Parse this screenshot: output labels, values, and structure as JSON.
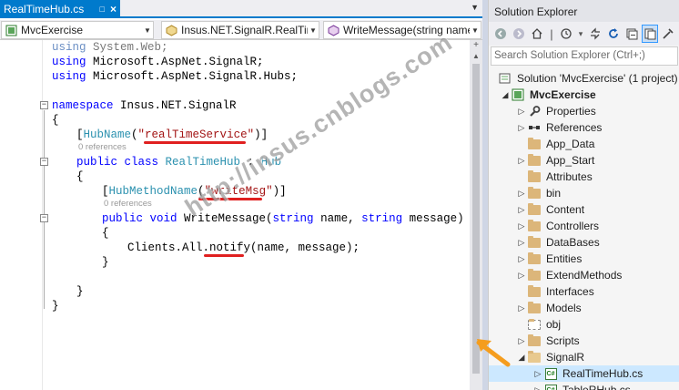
{
  "editor": {
    "tab": {
      "label": "RealTimeHub.cs",
      "pin": "□",
      "close": "×"
    },
    "tab_overflow": "▼",
    "nav": {
      "project": "MvcExercise",
      "class": "Insus.NET.SignalR.RealTim",
      "member": "WriteMessage(string name"
    },
    "code": {
      "l1": "using System.Web;",
      "l2": "using Microsoft.AspNet.SignalR;",
      "l3": "using Microsoft.AspNet.SignalR.Hubs;",
      "ns_kw": "namespace",
      "ns_name": " Insus.NET.SignalR",
      "brace_open": "{",
      "brace_close": "}",
      "attr1_pre": "[",
      "attr1_type": "HubName",
      "attr1_paren": "(",
      "attr1_str": "\"realTimeService\"",
      "attr1_post": ")]",
      "refs": "0 references",
      "class_kw": "public class",
      "class_name": "RealTimeHub",
      "class_sep": " : ",
      "class_base": "Hub",
      "attr2_type": "HubMethodName",
      "attr2_str": "\"writeMsg\"",
      "method_kw": "public void",
      "method_name": " WriteMessage(",
      "method_p1_kw": "string",
      "method_p1": " name, ",
      "method_p2_kw": "string",
      "method_p2": " message)",
      "call_pre": "Clients.All.",
      "call_fn": "notify",
      "call_post": "(name, message);"
    }
  },
  "solution_explorer": {
    "title": "Solution Explorer",
    "search_placeholder": "Search Solution Explorer (Ctrl+;)",
    "solution_label": "Solution 'MvcExercise' (1 project)",
    "project_label": "MvcExercise",
    "items": [
      {
        "label": "Properties",
        "icon": "wrench-icon"
      },
      {
        "label": "References",
        "icon": "references-icon"
      },
      {
        "label": "App_Data",
        "icon": "folder-icon"
      },
      {
        "label": "App_Start",
        "icon": "folder-icon"
      },
      {
        "label": "Attributes",
        "icon": "folder-icon"
      },
      {
        "label": "bin",
        "icon": "folder-icon"
      },
      {
        "label": "Content",
        "icon": "folder-icon"
      },
      {
        "label": "Controllers",
        "icon": "folder-icon"
      },
      {
        "label": "DataBases",
        "icon": "folder-icon"
      },
      {
        "label": "Entities",
        "icon": "folder-icon"
      },
      {
        "label": "ExtendMethods",
        "icon": "folder-icon"
      },
      {
        "label": "Interfaces",
        "icon": "folder-icon"
      },
      {
        "label": "Models",
        "icon": "folder-icon"
      },
      {
        "label": "obj",
        "icon": "folder-dashed-icon"
      },
      {
        "label": "Scripts",
        "icon": "folder-icon"
      },
      {
        "label": "SignalR",
        "icon": "folder-open-icon"
      },
      {
        "label": "RealTimeHub.cs",
        "icon": "csharp-file-icon"
      },
      {
        "label": "TableRHub.cs",
        "icon": "csharp-file-icon"
      }
    ]
  },
  "watermark": "http://insus.cnblogs.com",
  "colors": {
    "accent": "#007acc",
    "keyword": "#0000ff",
    "type": "#2b91af",
    "string": "#a31515",
    "underline": "#e02020",
    "arrow": "#f59d1e"
  }
}
